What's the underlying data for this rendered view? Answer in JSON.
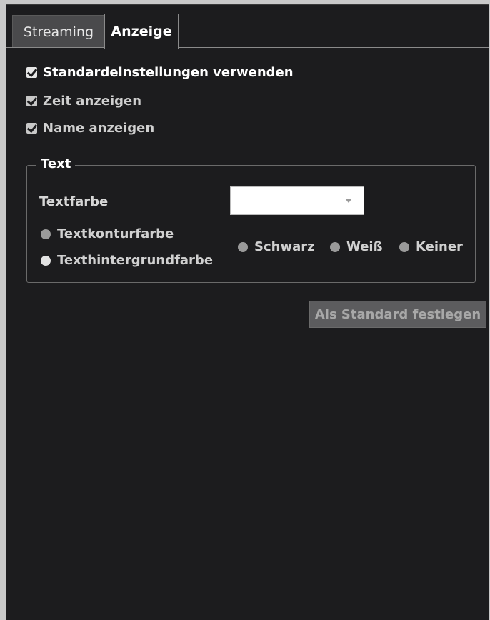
{
  "tabs": [
    {
      "label": "Streaming",
      "active": false
    },
    {
      "label": "Anzeige",
      "active": true
    }
  ],
  "checkboxes": [
    {
      "label": "Standardeinstellungen verwenden",
      "checked": true
    },
    {
      "label": "Zeit anzeigen",
      "checked": true
    },
    {
      "label": "Name anzeigen",
      "checked": true
    }
  ],
  "text_group": {
    "legend": "Text",
    "textfarbe_label": "Textfarbe",
    "textfarbe_value": "",
    "target_options": [
      {
        "label": "Textkonturfarbe",
        "selected": false
      },
      {
        "label": "Texthintergrundfarbe",
        "selected": true
      }
    ],
    "color_options": [
      {
        "label": "Schwarz"
      },
      {
        "label": "Weiß"
      },
      {
        "label": "Keiner"
      }
    ]
  },
  "set_default_button": "Als Standard festlegen",
  "colors": {
    "background": "#1c1c1e",
    "inactive_tab": "#4a4a4c",
    "button_disabled": "#5c5c5e"
  }
}
